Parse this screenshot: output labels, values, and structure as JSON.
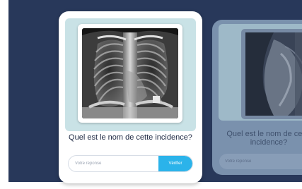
{
  "colors": {
    "background_panel": "#28385a",
    "card_image_area": "#c9e2e6",
    "check_button": "#2bb3ea",
    "question_text": "#1f2a44"
  },
  "current_card": {
    "image_icon": "chest-xray-frontal-image",
    "question": "Quel est le nom de cette incidence?",
    "answer_placeholder": "Votre réponse",
    "check_label": "Vérifier"
  },
  "next_card": {
    "image_icon": "chest-xray-lateral-image",
    "question": "Quel est le nom de cette incidence?",
    "answer_placeholder": "Votre réponse"
  }
}
